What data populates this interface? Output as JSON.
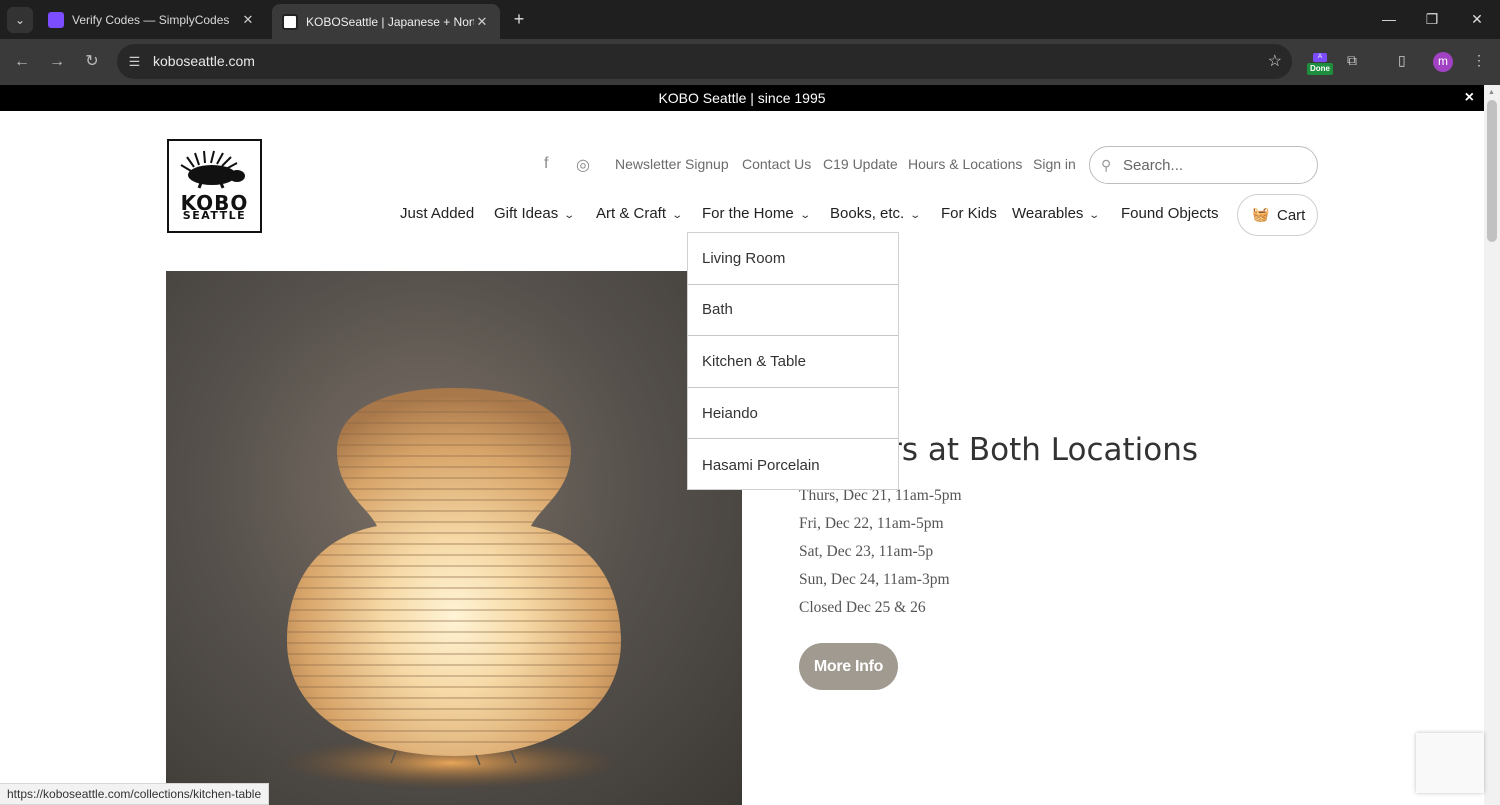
{
  "browser": {
    "tabs": [
      {
        "title": "Verify Codes — SimplyCodes",
        "active": false
      },
      {
        "title": "KOBOSeattle | Japanese + North",
        "active": true
      }
    ],
    "url": "koboseattle.com",
    "extension_badge": {
      "top": "A",
      "bottom": "Done"
    },
    "profile_initial": "m"
  },
  "announcement": {
    "text": "KOBO Seattle | since 1995",
    "close": "×"
  },
  "logo": {
    "line1": "KOBO",
    "line2": "SEATTLE"
  },
  "top_links": [
    "Newsletter Signup",
    "Contact Us",
    "C19 Update",
    "Hours & Locations",
    "Sign in"
  ],
  "search": {
    "placeholder": "Search..."
  },
  "main_nav": [
    {
      "label": "Just Added",
      "has_menu": false
    },
    {
      "label": "Gift Ideas",
      "has_menu": true
    },
    {
      "label": "Art & Craft",
      "has_menu": true
    },
    {
      "label": "For the Home",
      "has_menu": true
    },
    {
      "label": "Books, etc.",
      "has_menu": true
    },
    {
      "label": "For Kids",
      "has_menu": false
    },
    {
      "label": "Wearables",
      "has_menu": true
    },
    {
      "label": "Found Objects",
      "has_menu": false
    }
  ],
  "cart": {
    "label": "Cart"
  },
  "dropdown": {
    "parent": "For the Home",
    "items": [
      "Living Room",
      "Bath",
      "Kitchen & Table",
      "Heiando",
      "Hasami Porcelain"
    ]
  },
  "hero": {
    "heading": "y Hours at Both Locations",
    "hours": [
      "Thurs, Dec 21, 11am-5pm",
      "Fri, Dec 22, 11am-5pm",
      "Sat, Dec 23, 11am-5p",
      "Sun, Dec 24, 11am-3pm",
      "Closed Dec 25 & 26"
    ],
    "button": "More Info"
  },
  "status_bar": {
    "url": "https://koboseattle.com/collections/kitchen-table"
  }
}
